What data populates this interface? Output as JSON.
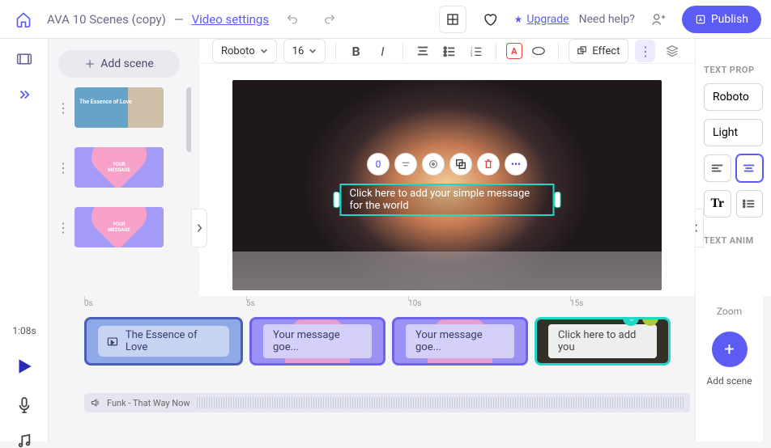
{
  "topbar": {
    "project_title": "AVA 10 Scenes (copy)",
    "separator": "—",
    "settings_link": "Video settings",
    "upgrade": "Upgrade",
    "need_help": "Need help?",
    "publish": "Publish"
  },
  "scenes_panel": {
    "add_scene": "Add scene",
    "thumbs": [
      {
        "caption": "The Essence of Love"
      },
      {
        "caption": "YOUR MESSAGE"
      },
      {
        "caption": "YOUR MESSAGE"
      }
    ]
  },
  "format_toolbar": {
    "font": "Roboto",
    "size": "16",
    "effect": "Effect"
  },
  "canvas": {
    "badge": "0",
    "edit_placeholder": "Click here to add your simple message for the world"
  },
  "right_panel": {
    "section1": "TEXT PROP",
    "font": "Roboto",
    "weight": "Light",
    "section2": "TEXT ANIM"
  },
  "timeline": {
    "time": "1:08s",
    "ticks": [
      "0s",
      "5s",
      "10s",
      "15s"
    ],
    "clips": [
      "The Essence of Love",
      "Your message goe...",
      "Your message goe...",
      "Click here to add you"
    ],
    "audio": "Funk - That Way Now"
  },
  "zoom_add": {
    "zoom": "Zoom",
    "label": "Add scene"
  }
}
